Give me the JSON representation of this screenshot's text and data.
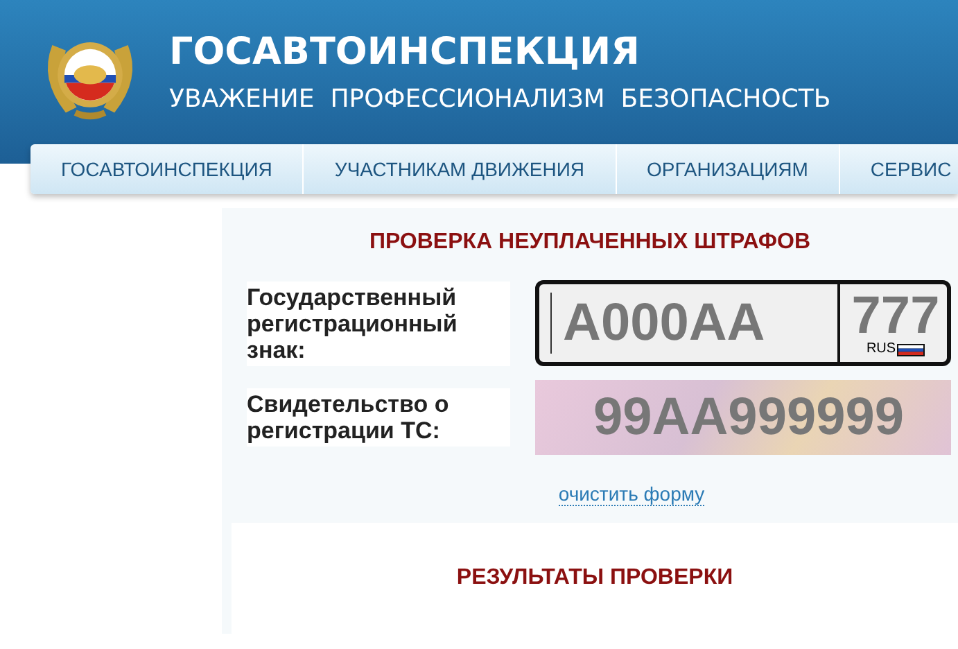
{
  "header": {
    "title": "ГОСАВТОИНСПЕКЦИЯ",
    "slogan": "УВАЖЕНИЕ  ПРОФЕССИОНАЛИЗМ  БЕЗОПАСНОСТЬ"
  },
  "nav": [
    {
      "label": "ГОСАВТОИНСПЕКЦИЯ",
      "selected": false
    },
    {
      "label": "УЧАСТНИКАМ ДВИЖЕНИЯ",
      "selected": false
    },
    {
      "label": "ОРГАНИЗАЦИЯМ",
      "selected": false
    },
    {
      "label": "СЕРВИС",
      "selected": false
    }
  ],
  "form": {
    "title": "ПРОВЕРКА НЕУПЛАЧЕННЫХ ШТРАФОВ",
    "plate": {
      "label": "Государственный регистрационный знак:",
      "number_placeholder": "A000AA",
      "region_placeholder": "777",
      "country": "RUS"
    },
    "certificate": {
      "label": "Свидетельство о регистрации ТС:",
      "placeholder": "99AA999999"
    },
    "clear_link": "очистить форму"
  },
  "results": {
    "title": "РЕЗУЛЬТАТЫ ПРОВЕРКИ"
  }
}
